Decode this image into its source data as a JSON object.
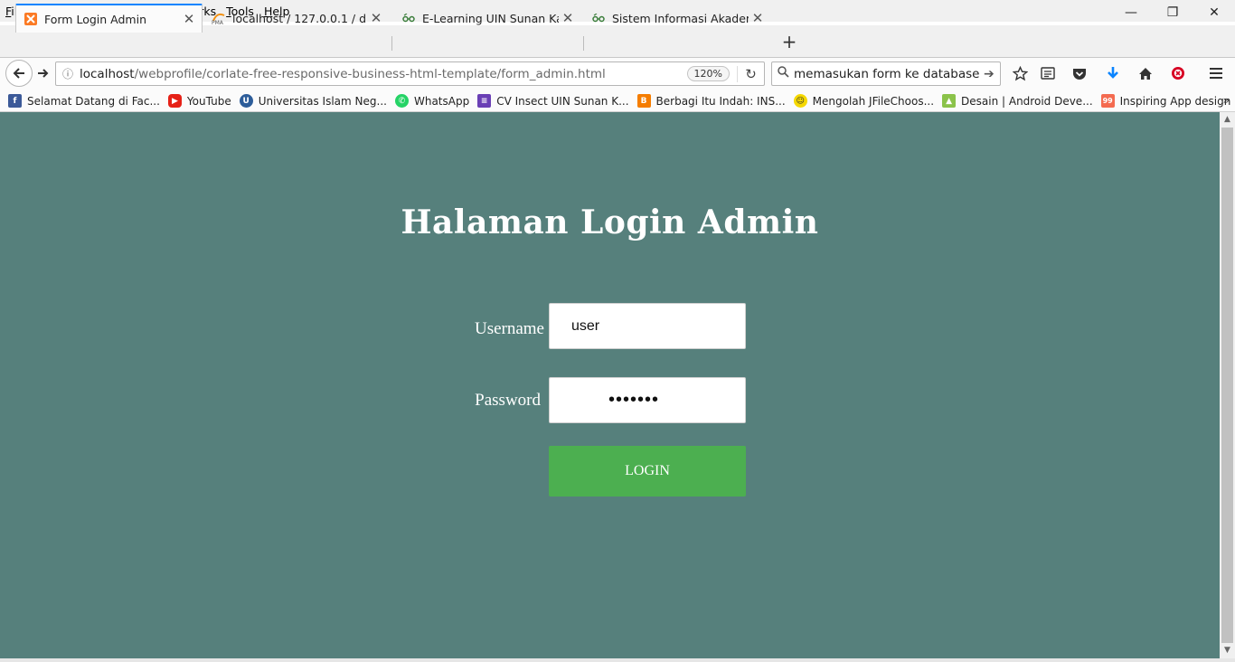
{
  "menu": [
    {
      "pre": "",
      "u": "F",
      "post": "ile"
    },
    {
      "pre": "",
      "u": "E",
      "post": "dit"
    },
    {
      "pre": "",
      "u": "V",
      "post": "iew"
    },
    {
      "pre": "Hi",
      "u": "s",
      "post": "tory"
    },
    {
      "pre": "",
      "u": "B",
      "post": "ookmarks"
    },
    {
      "pre": "",
      "u": "T",
      "post": "ools"
    },
    {
      "pre": "",
      "u": "H",
      "post": "elp"
    }
  ],
  "window": {
    "minimize": "—",
    "restore": "❐",
    "close": "✕"
  },
  "tabs": [
    {
      "title": "Form Login Admin",
      "close": "✕"
    },
    {
      "title": "localhost / 127.0.0.1 / db_s...",
      "close": "✕"
    },
    {
      "title": "E-Learning UIN Sunan Kali...",
      "close": "✕"
    },
    {
      "title": "Sistem Informasi Akademi...",
      "close": "✕"
    }
  ],
  "newtab": "+",
  "nav": {
    "back": "🡐",
    "forward": "🡒",
    "info": "ⓘ",
    "reload": "↻"
  },
  "url": {
    "host": "localhost",
    "path": "/webprofile/corlate-free-responsive-business-html-template/form_admin.html",
    "zoom": "120%"
  },
  "search": {
    "value": "memasukan form ke database sql",
    "go": "➔",
    "icon": "⌕"
  },
  "toolbar_icons": [
    "star-icon",
    "reading-list-icon",
    "pocket-icon",
    "download-icon",
    "home-icon",
    "addon-icon",
    "hamburger-menu-icon"
  ],
  "bookmarks": [
    {
      "label": "Selamat Datang di Fac...",
      "icon": "facebook-icon",
      "color": "#3b5998",
      "glyph": "f"
    },
    {
      "label": "YouTube",
      "icon": "youtube-icon",
      "color": "#e62117",
      "glyph": "▶"
    },
    {
      "label": "Universitas Islam Neg...",
      "icon": "uin-icon",
      "color": "#2d5d9a",
      "glyph": "U"
    },
    {
      "label": "WhatsApp",
      "icon": "whatsapp-icon",
      "color": "#25d366",
      "glyph": "✆"
    },
    {
      "label": "CV Insect UIN Sunan K...",
      "icon": "list-icon",
      "color": "#6a3fb5",
      "glyph": "≡"
    },
    {
      "label": "Berbagi Itu Indah: INS...",
      "icon": "blogger-icon",
      "color": "#f57d00",
      "glyph": "B"
    },
    {
      "label": "Mengolah JFileChoos...",
      "icon": "smiley-icon",
      "color": "#f5d800",
      "glyph": "☺"
    },
    {
      "label": "Desain | Android Deve...",
      "icon": "android-icon",
      "color": "#8bc34a",
      "glyph": "▲"
    },
    {
      "label": "Inspiring App design ...",
      "icon": "99designs-icon",
      "color": "#f46b50",
      "glyph": "99"
    }
  ],
  "bookmarks_more": "»",
  "page": {
    "heading": "Halaman Login Admin",
    "username_label": "Username",
    "username_value": "user",
    "password_label": "Password",
    "password_value": "•••••••",
    "login_label": "LOGIN"
  },
  "colors": {
    "page_bg": "#56807c",
    "button_bg": "#4caf50",
    "accent": "#0a84ff"
  }
}
